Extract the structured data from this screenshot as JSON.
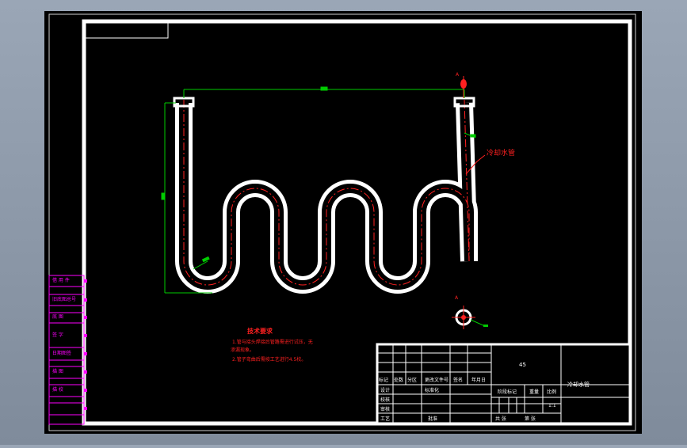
{
  "drawing": {
    "section_marker": "A",
    "view_label": "A",
    "callout_label": "冷却水管",
    "notes": {
      "title": "技术要求",
      "line1": "1.管与接头焊接后管路需进行试压，无",
      "line2": "渗漏现象。",
      "line3": "2.管子弯曲后需按工艺进行4.5校。"
    }
  },
  "left_stamps": [
    "借 用 件",
    "旧底图总号",
    "底 图",
    "签 字",
    "日期图签",
    "描 图",
    "描 校"
  ],
  "title_block": {
    "material": "45",
    "part_name": "冷却水管",
    "change_header": [
      "标记",
      "处数",
      "分区",
      "更改文件号",
      "签名",
      "年月日"
    ],
    "row_labels": [
      "设计",
      "校核",
      "审核",
      "工艺"
    ],
    "standardization": "标准化",
    "approve": "批准",
    "stage_mark": "阶段标记",
    "weight": "重量",
    "scale": "比例",
    "scale_value": "1:1",
    "sheet_total": "共  张",
    "sheet_no": "第  张"
  },
  "colors": {
    "paper": "#000000",
    "frame": "#ffffff",
    "dimension": "#00cc00",
    "centerline": "#ff2020",
    "stamps": "#ff00ff",
    "notes": "#ff2020"
  }
}
